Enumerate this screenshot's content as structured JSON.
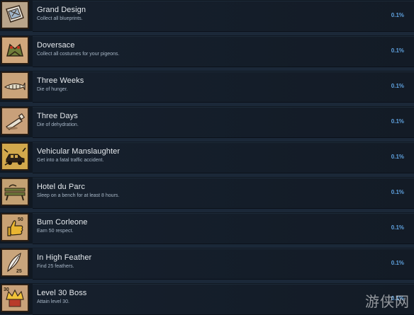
{
  "achievements": [
    {
      "title": "Grand Design",
      "desc": "Collect all blueprints.",
      "pct": "0.1%",
      "icon": "blueprints-icon",
      "bg": "#b9a48a"
    },
    {
      "title": "Doversace",
      "desc": "Collect all costumes for your pigeons.",
      "pct": "0.1%",
      "icon": "pigeon-costume-icon",
      "bg": "#d0a77c"
    },
    {
      "title": "Three Weeks",
      "desc": "Die of hunger.",
      "pct": "0.1%",
      "icon": "fish-bones-icon",
      "bg": "#c9a37a"
    },
    {
      "title": "Three Days",
      "desc": "Die of dehydration.",
      "pct": "0.1%",
      "icon": "empty-bottle-icon",
      "bg": "#c8a07a"
    },
    {
      "title": "Vehicular Manslaughter",
      "desc": "Get into a fatal traffic accident.",
      "pct": "0.1%",
      "icon": "car-crash-icon",
      "bg": "#d2a84c"
    },
    {
      "title": "Hotel du Parc",
      "desc": "Sleep on a bench for at least 8 hours.",
      "pct": "0.1%",
      "icon": "bench-icon",
      "bg": "#c3a173"
    },
    {
      "title": "Bum Corleone",
      "desc": "Earn 50 respect.",
      "pct": "0.1%",
      "icon": "thumbs-up-icon",
      "bg": "#c8a174",
      "badge": "50"
    },
    {
      "title": "In High Feather",
      "desc": "Find 25 feathers.",
      "pct": "0.1%",
      "icon": "feather-icon",
      "bg": "#c9a57c",
      "badge": "25"
    },
    {
      "title": "Level 30 Boss",
      "desc": "Attain level 30.",
      "pct": "0.1%",
      "icon": "crown-icon",
      "bg": "#c9a27a",
      "badge": "30"
    }
  ],
  "watermark": "游侠网"
}
